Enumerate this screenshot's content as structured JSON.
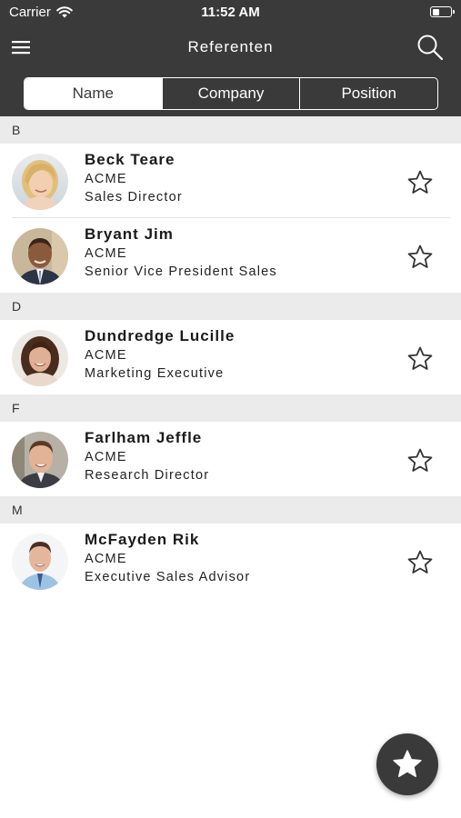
{
  "status_bar": {
    "carrier": "Carrier",
    "time": "11:52 AM",
    "icons": [
      "wifi-icon",
      "battery-icon"
    ]
  },
  "nav": {
    "title": "Referenten",
    "menu_icon": "hamburger-menu-icon",
    "search_icon": "search-icon"
  },
  "tabs": [
    {
      "label": "Name",
      "selected": true
    },
    {
      "label": "Company",
      "selected": false
    },
    {
      "label": "Position",
      "selected": false
    }
  ],
  "sections": [
    {
      "letter": "B",
      "contacts": [
        {
          "name": "Beck Teare",
          "company": "ACME",
          "position": "Sales Director",
          "favorite": false
        },
        {
          "name": "Bryant Jim",
          "company": "ACME",
          "position": "Senior Vice President Sales",
          "favorite": false
        }
      ]
    },
    {
      "letter": "D",
      "contacts": [
        {
          "name": "Dundredge Lucille",
          "company": "ACME",
          "position": "Marketing Executive",
          "favorite": false
        }
      ]
    },
    {
      "letter": "F",
      "contacts": [
        {
          "name": "Farlham Jeffle",
          "company": "ACME",
          "position": "Research Director",
          "favorite": false
        }
      ]
    },
    {
      "letter": "M",
      "contacts": [
        {
          "name": "McFayden Rik",
          "company": "ACME",
          "position": "Executive Sales Advisor",
          "favorite": false
        }
      ]
    }
  ],
  "fab": {
    "icon": "star-icon"
  },
  "colors": {
    "bar": "#3a3a3a",
    "section_bg": "#ebebeb",
    "text": "#1a1a1a"
  }
}
